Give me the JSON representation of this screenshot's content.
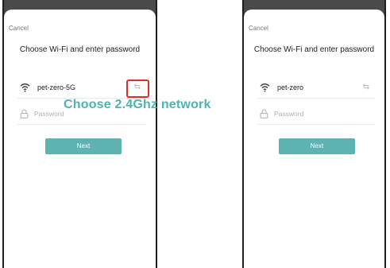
{
  "left_screen": {
    "cancel_label": "Cancel",
    "title": "Choose Wi-Fi and enter password",
    "wifi_ssid": "pet-zero-5G",
    "password_placeholder": "Password",
    "password_value": "",
    "next_label": "Next",
    "icons": {
      "wifi": "wifi-icon",
      "switch": "switch-network-icon",
      "lock": "lock-icon"
    }
  },
  "right_screen": {
    "cancel_label": "Cancel",
    "title": "Choose Wi-Fi and enter password",
    "wifi_ssid": "pet-zero",
    "password_placeholder": "Password",
    "password_value": "",
    "next_label": "Next",
    "icons": {
      "wifi": "wifi-icon",
      "switch": "switch-network-icon",
      "lock": "lock-icon"
    }
  },
  "annotation": {
    "text": "Choose 2.4Ghz network",
    "text_color": "#4db3b3",
    "highlight_color": "#e02b2b"
  },
  "colors": {
    "accent": "#5fb2b2",
    "phone_frame": "#4a4a4a"
  }
}
